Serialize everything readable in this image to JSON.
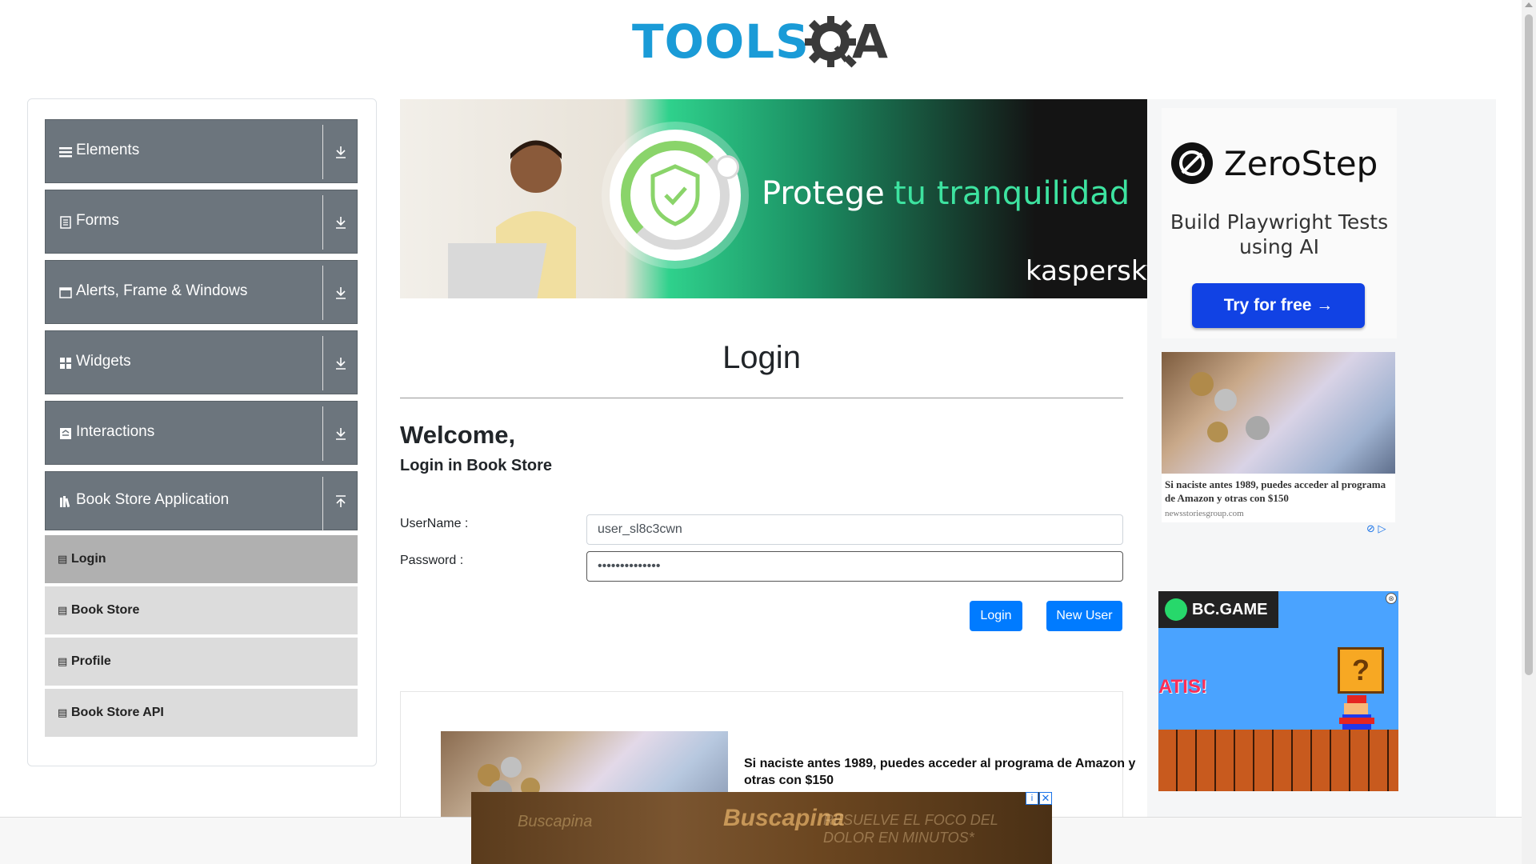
{
  "header": {
    "logo_text": "TOOLS",
    "logo_suffix": "A"
  },
  "sidebar": {
    "groups": [
      {
        "label": "Elements",
        "icon": "hamburger-icon",
        "arrow": "download-arrow-icon"
      },
      {
        "label": "Forms",
        "icon": "document-icon",
        "arrow": "download-arrow-icon"
      },
      {
        "label": "Alerts, Frame & Windows",
        "icon": "window-icon",
        "arrow": "download-arrow-icon"
      },
      {
        "label": "Widgets",
        "icon": "grid-icon",
        "arrow": "download-arrow-icon"
      },
      {
        "label": "Interactions",
        "icon": "interaction-icon",
        "arrow": "download-arrow-icon"
      },
      {
        "label": "Book Store Application",
        "icon": "books-icon",
        "arrow": "upload-arrow-icon"
      }
    ],
    "subitems": [
      {
        "label": "Login",
        "active": true
      },
      {
        "label": "Book Store",
        "active": false
      },
      {
        "label": "Profile",
        "active": false
      },
      {
        "label": "Book Store API",
        "active": false
      }
    ]
  },
  "banner": {
    "text1": "Protege",
    "text2": "tu tranquilidad",
    "brand": "kaspersky"
  },
  "login": {
    "title": "Login",
    "welcome": "Welcome,",
    "subtitle": "Login in Book Store",
    "username_label": "UserName :",
    "username_value": "user_sl8c3cwn",
    "password_label": "Password :",
    "password_value": "••••••••••••••",
    "login_button": "Login",
    "new_user_button": "New User"
  },
  "content_ad": {
    "headline": "Si naciste antes 1989, puedes acceder al programa de Amazon y otras con $150"
  },
  "right_ads": {
    "zerostep": {
      "name": "ZeroStep",
      "tagline": "Build Playwright Tests using AI",
      "button": "Try for free →"
    },
    "native": {
      "text": "Si naciste antes 1989, puedes acceder al programa de Amazon y otras con $150",
      "source": "newsstoriesgroup.com"
    },
    "bcgame": {
      "brand": "BC.GAME",
      "snippet": "ATIS!",
      "question": "?"
    }
  },
  "bottom_ad": {
    "brand1": "Buscapina",
    "brand2": "Buscapina",
    "slogan": "RESUELVE EL FOCO DEL DOLOR EN MINUTOS*"
  }
}
